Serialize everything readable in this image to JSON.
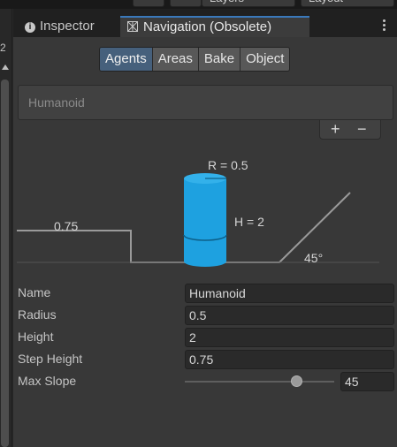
{
  "tabs": {
    "inspector": "Inspector",
    "navigation": "Navigation (Obsolete)"
  },
  "topbar": {
    "layers": "Layers",
    "layout": "Layout"
  },
  "left_strip": {
    "number": "2"
  },
  "nav_tabs": [
    "Agents",
    "Areas",
    "Bake",
    "Object"
  ],
  "active_nav_tab": "Agents",
  "agent_list": {
    "items": [
      "Humanoid"
    ]
  },
  "diagram": {
    "radius_label": "R = 0.5",
    "height_label": "H = 2",
    "step_label": "0.75",
    "slope_label": "45°",
    "cylinder_color": "#1ea1e0"
  },
  "fields": {
    "name": {
      "label": "Name",
      "value": "Humanoid"
    },
    "radius": {
      "label": "Radius",
      "value": "0.5"
    },
    "height": {
      "label": "Height",
      "value": "2"
    },
    "step_height": {
      "label": "Step Height",
      "value": "0.75"
    },
    "max_slope": {
      "label": "Max Slope",
      "value": "45",
      "slider_fraction": 0.75
    }
  },
  "colors": {
    "active_tab": "#46607c",
    "accent": "#3a79bb"
  }
}
